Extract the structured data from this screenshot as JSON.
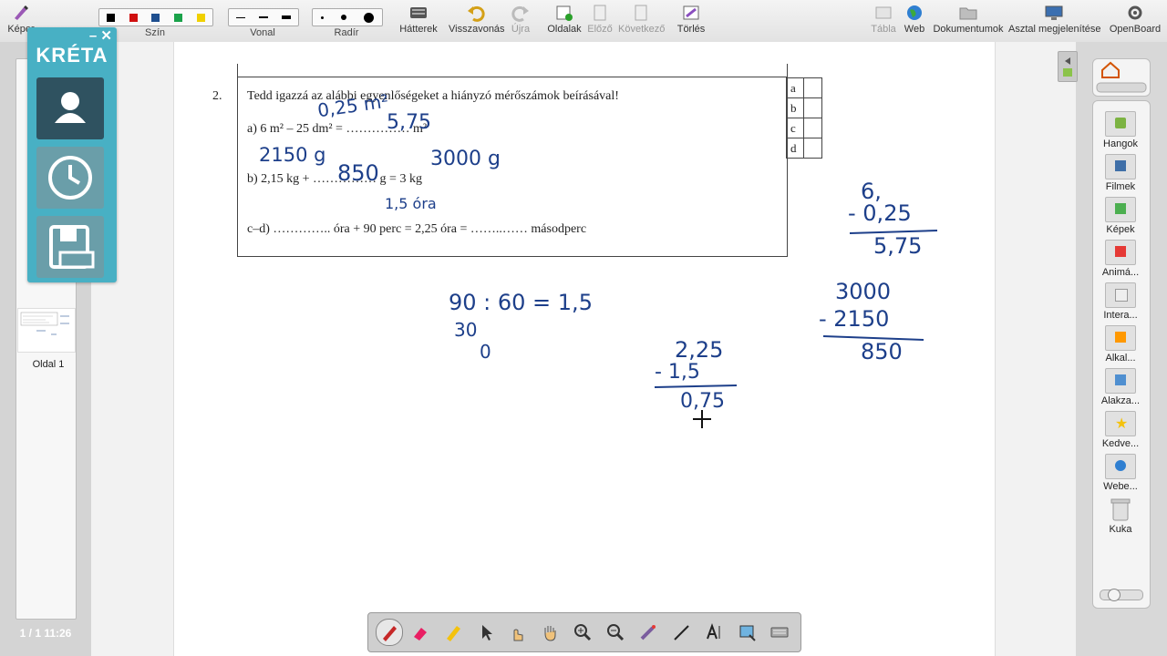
{
  "toolbar": {
    "items": [
      {
        "label": "Képer"
      },
      {
        "label": "Szín"
      },
      {
        "label": "Vonal"
      },
      {
        "label": "Radír"
      },
      {
        "label": "Hátterek"
      },
      {
        "label": "Visszavonás"
      },
      {
        "label": "Újra"
      },
      {
        "label": "Oldalak"
      },
      {
        "label": "Előző"
      },
      {
        "label": "Következő"
      },
      {
        "label": "Törlés"
      },
      {
        "label": "Tábla"
      },
      {
        "label": "Web"
      },
      {
        "label": "Dokumentumok"
      },
      {
        "label": "Asztal megjelenítése"
      },
      {
        "label": "OpenBoard"
      }
    ],
    "colors": [
      "#000000",
      "#d01010",
      "#1f4f8f",
      "#1aa24a",
      "#f0d000"
    ]
  },
  "kreta": {
    "logo": "KRÉTA",
    "close": "✕",
    "minimize": "–"
  },
  "pages": {
    "thumb_label": "Oldal 1",
    "pager": "1 / 1  11:26"
  },
  "library": {
    "items": [
      {
        "label": "Hangok"
      },
      {
        "label": "Filmek"
      },
      {
        "label": "Képek"
      },
      {
        "label": "Animá..."
      },
      {
        "label": "Intera..."
      },
      {
        "label": "Alkal..."
      },
      {
        "label": "Alakza..."
      },
      {
        "label": "Kedve..."
      },
      {
        "label": "Webe..."
      },
      {
        "label": "Kuka"
      }
    ]
  },
  "task": {
    "number": "2.",
    "title": "Tedd igazzá az alábbi egyenlőségeket a hiányzó mérőszámok beírásával!",
    "a": "a)    6 m² – 25 dm² = …………… m²",
    "b": "b)    2,15 kg + …………… g = 3 kg",
    "cd": "c–d)   ………….. óra + 90 perc = 2,25 óra = ……..…… másodperc",
    "boxes": [
      "a",
      "b",
      "c",
      "d"
    ]
  },
  "ink": {
    "a1": "0,25 m²",
    "a2": "5,75",
    "b1": "2150 g",
    "b2": "850",
    "b3": "3000 g",
    "c1": "1,5 óra",
    "calc1_l1": "90 : 60 = 1,5",
    "calc1_l2": "30",
    "calc1_l3": "0",
    "calc2_l1": "2,25",
    "calc2_l2": "- 1,5",
    "calc2_l3": "0,75",
    "calc3_l1": "6,",
    "calc3_l2": "- 0,25",
    "calc3_l3": "5,75",
    "calc4_l1": "3000",
    "calc4_l2": "- 2150",
    "calc4_l3": "850"
  }
}
